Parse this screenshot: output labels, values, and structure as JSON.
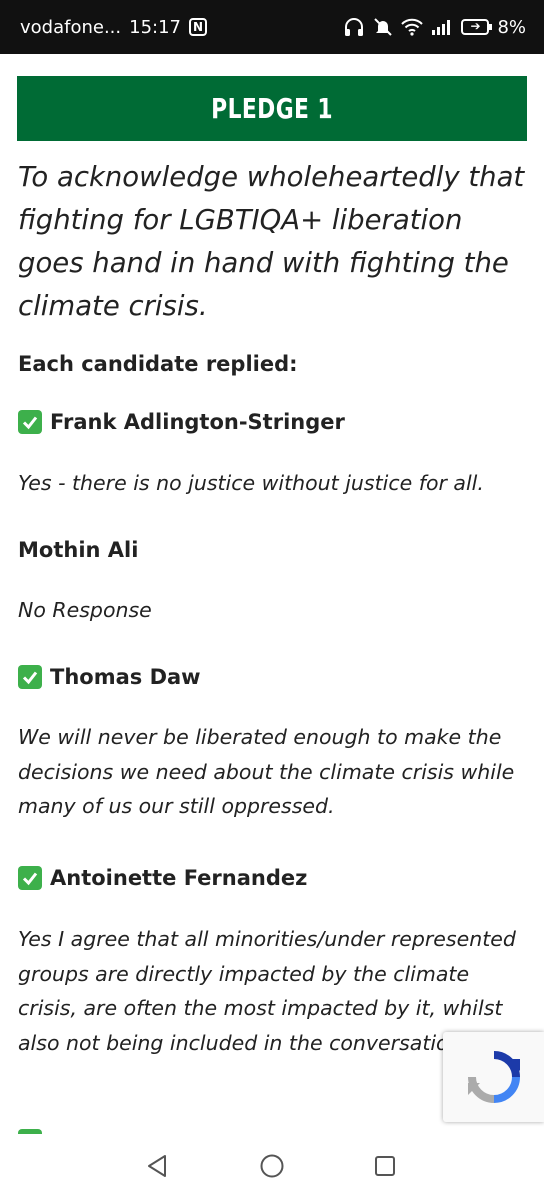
{
  "status_bar": {
    "carrier": "vodafone...",
    "time": "15:17",
    "battery": "8%"
  },
  "pledge": {
    "title": "PLEDGE 1",
    "text": "To acknowledge wholeheartedly that fighting for LGBTIQA+ liberation goes hand in hand with fighting the climate crisis."
  },
  "replies_heading": "Each candidate replied:",
  "candidates": [
    {
      "name": "Frank Adlington-Stringer",
      "checked": true,
      "reply": "Yes - there is no justice without justice for all."
    },
    {
      "name": "Mothin Ali",
      "checked": false,
      "reply": "No Response"
    },
    {
      "name": "Thomas Daw",
      "checked": true,
      "reply": "We will never be liberated enough to make the decisions we need about the climate crisis while many of us our still oppressed."
    },
    {
      "name": "Antoinette Fernandez",
      "checked": true,
      "reply": "Yes I agree that all minorities/under represented groups are directly impacted by the climate crisis, are often the most impacted by it, whilst also not being included in the conversation."
    }
  ],
  "colors": {
    "banner": "#006b35",
    "check": "#3db04b",
    "status_bar": "#111111"
  },
  "icons": {
    "nfc": "nfc-icon",
    "headphones": "headphones-icon",
    "mute": "bell-off-icon",
    "wifi": "wifi-icon",
    "signal": "signal-icon",
    "battery": "battery-charging-icon",
    "recaptcha": "recaptcha-icon",
    "back": "back-icon",
    "home": "home-icon",
    "recents": "recents-icon"
  }
}
